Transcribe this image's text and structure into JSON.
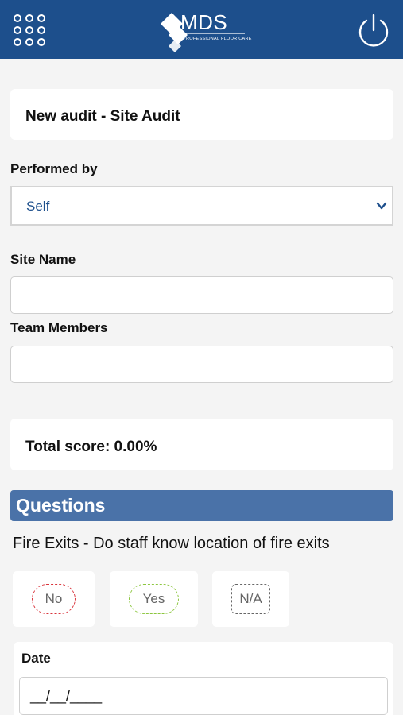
{
  "header": {
    "logo_text": "MDS",
    "logo_subtitle": "PROFESSIONAL FLOOR CARE",
    "brand_color": "#1d4f8c"
  },
  "page": {
    "title": "New audit - Site Audit"
  },
  "form": {
    "performed_by_label": "Performed by",
    "performed_by_value": "Self",
    "site_name_label": "Site Name",
    "site_name_value": "",
    "team_members_label": "Team Members",
    "team_members_value": ""
  },
  "score": {
    "text": "Total score: 0.00%"
  },
  "questions": {
    "header": "Questions",
    "items": [
      {
        "text": "Fire Exits - Do staff know location of fire exits",
        "answers": [
          {
            "label": "No",
            "color": "#d9333b"
          },
          {
            "label": "Yes",
            "color": "#8cc63f"
          },
          {
            "label": "N/A",
            "color": "#666666"
          }
        ],
        "date_label": "Date",
        "date_value": "__/__/____"
      }
    ]
  }
}
